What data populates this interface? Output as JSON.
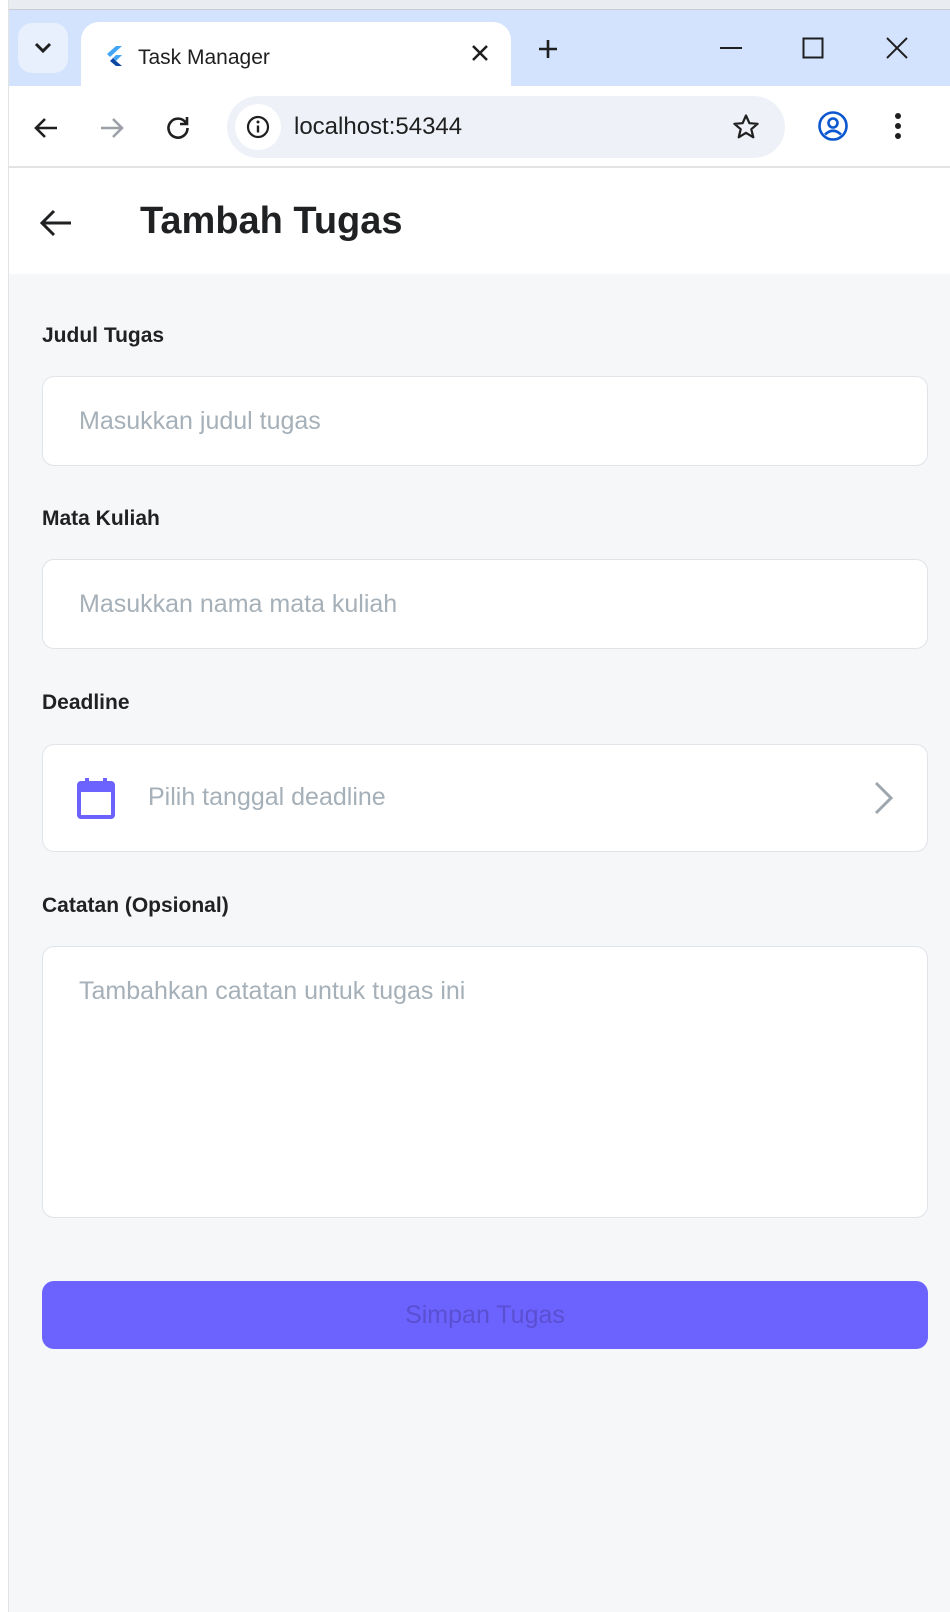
{
  "browser": {
    "tab_title": "Task Manager",
    "url": "localhost:54344"
  },
  "app": {
    "title": "Tambah Tugas",
    "accent_color": "#6c63ff"
  },
  "form": {
    "title_field": {
      "label": "Judul Tugas",
      "placeholder": "Masukkan judul tugas",
      "value": ""
    },
    "course_field": {
      "label": "Mata Kuliah",
      "placeholder": "Masukkan nama mata kuliah",
      "value": ""
    },
    "deadline_field": {
      "label": "Deadline",
      "placeholder": "Pilih tanggal deadline",
      "icon": "calendar-icon"
    },
    "notes_field": {
      "label": "Catatan (Opsional)",
      "placeholder": "Tambahkan catatan untuk tugas ini",
      "value": ""
    },
    "save_label": "Simpan Tugas"
  }
}
